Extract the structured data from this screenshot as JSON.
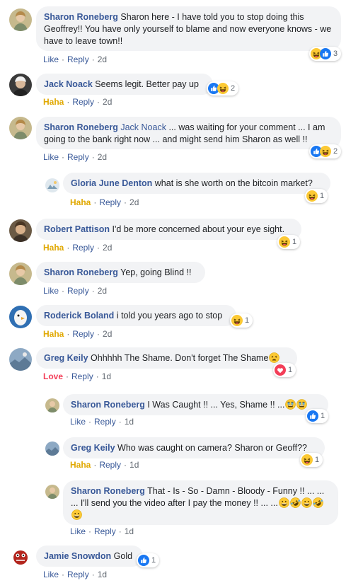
{
  "colors": {
    "link": "#385898",
    "bubble_bg": "#f2f3f5",
    "meta_text": "#606770",
    "haha": "#e0a800",
    "love": "#f33e58",
    "like_blue": "#1877f2"
  },
  "labels": {
    "like": "Like",
    "reply": "Reply",
    "haha": "Haha",
    "love": "Love",
    "dot": "·"
  },
  "comments": [
    {
      "author": "Sharon Roneberg",
      "text": "Sharon here - I have told you to stop doing this Geoffrey!! You have only yourself to blame and now everyone knows - we have to leave town!!",
      "reaction_label": "Like",
      "time": "2d",
      "reactions": [
        "haha-icon",
        "like-icon"
      ],
      "reaction_count": "3"
    },
    {
      "author": "Jack Noack",
      "text": "Seems legit. Better pay up",
      "reaction_label": "Haha",
      "time": "2d",
      "reactions": [
        "like-icon",
        "haha-icon"
      ],
      "reaction_count": "2"
    },
    {
      "author": "Sharon Roneberg",
      "tag": "Jack Noack",
      "text": "... was waiting for your comment ... I am going to the bank right now ... and might send him Sharon as well !!",
      "reaction_label": "Like",
      "time": "2d",
      "reactions": [
        "like-icon",
        "haha-icon"
      ],
      "reaction_count": "2"
    },
    {
      "author": "Gloria June Denton",
      "text": "what is she worth on the bitcoin market?",
      "reaction_label": "Haha",
      "time": "2d",
      "reactions": [
        "haha-icon"
      ],
      "reaction_count": "1"
    },
    {
      "author": "Robert Pattison",
      "text": "I'd be more concerned about your eye sight.",
      "reaction_label": "Haha",
      "time": "2d",
      "reactions": [
        "haha-icon"
      ],
      "reaction_count": "1"
    },
    {
      "author": "Sharon Roneberg",
      "text": "Yep, going Blind !!",
      "reaction_label": "Like",
      "time": "2d"
    },
    {
      "author": "Roderick Boland",
      "text": "i told you years ago to stop",
      "reaction_label": "Haha",
      "time": "2d",
      "reactions": [
        "haha-icon"
      ],
      "reaction_count": "1"
    },
    {
      "author": "Greg Keily",
      "text": "Ohhhhh The Shame. Don't forget The Shame",
      "inline_emoji": [
        "tired-face-emoji"
      ],
      "reaction_label": "Love",
      "time": "1d",
      "reactions": [
        "love-icon"
      ],
      "reaction_count": "1"
    },
    {
      "author": "Sharon Roneberg",
      "text": "I Was Caught !! ... Yes, Shame !! ...",
      "inline_emoji": [
        "crying-face-emoji",
        "crying-face-emoji"
      ],
      "reaction_label": "Like",
      "time": "1d",
      "reactions": [
        "like-icon"
      ],
      "reaction_count": "1"
    },
    {
      "author": "Greg Keily",
      "text": "Who was caught on camera? Sharon or Geoff??",
      "reaction_label": "Haha",
      "time": "1d",
      "reactions": [
        "haha-icon"
      ],
      "reaction_count": "1"
    },
    {
      "author": "Sharon Roneberg",
      "text": "That - Is - So - Damn - Bloody - Funny !! ... ... ... I'll send you the video after I pay the money !! ... ...",
      "inline_emoji": [
        "grinning-emoji",
        "rofl-emoji",
        "grinning-emoji",
        "rofl-emoji",
        "grinning-emoji"
      ],
      "reaction_label": "Like",
      "time": "1d"
    },
    {
      "author": "Jamie Snowdon",
      "text": "Gold",
      "reaction_label": "Like",
      "time": "1d",
      "reactions": [
        "like-icon"
      ],
      "reaction_count": "1"
    }
  ]
}
